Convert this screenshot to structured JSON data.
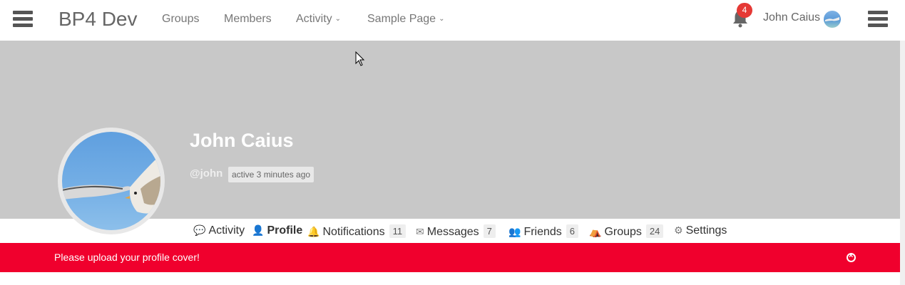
{
  "brand": "BP4 Dev",
  "nav": {
    "groups": "Groups",
    "members": "Members",
    "activity": "Activity",
    "sample_page": "Sample Page"
  },
  "notifications_badge": "4",
  "user": {
    "name": "John Caius",
    "display_name": "John Caius",
    "handle": "@john",
    "last_active": "active 3 minutes ago"
  },
  "tabs": [
    {
      "label": "Activity",
      "icon": "comments-icon"
    },
    {
      "label": "Profile",
      "icon": "user-icon",
      "active": true
    },
    {
      "label": "Notifications",
      "icon": "bell-icon",
      "count": "11"
    },
    {
      "label": "Messages",
      "icon": "envelope-icon",
      "count": "7"
    },
    {
      "label": "Friends",
      "icon": "users-icon",
      "count": "6"
    },
    {
      "label": "Groups",
      "icon": "groups-icon",
      "count": "24"
    },
    {
      "label": "Settings",
      "icon": "gear-icon"
    }
  ],
  "notice": {
    "text": "Please upload your profile cover!",
    "color": "#f0002d"
  },
  "colors": {
    "cover": "#c8c8c8",
    "badge": "#e53935"
  }
}
